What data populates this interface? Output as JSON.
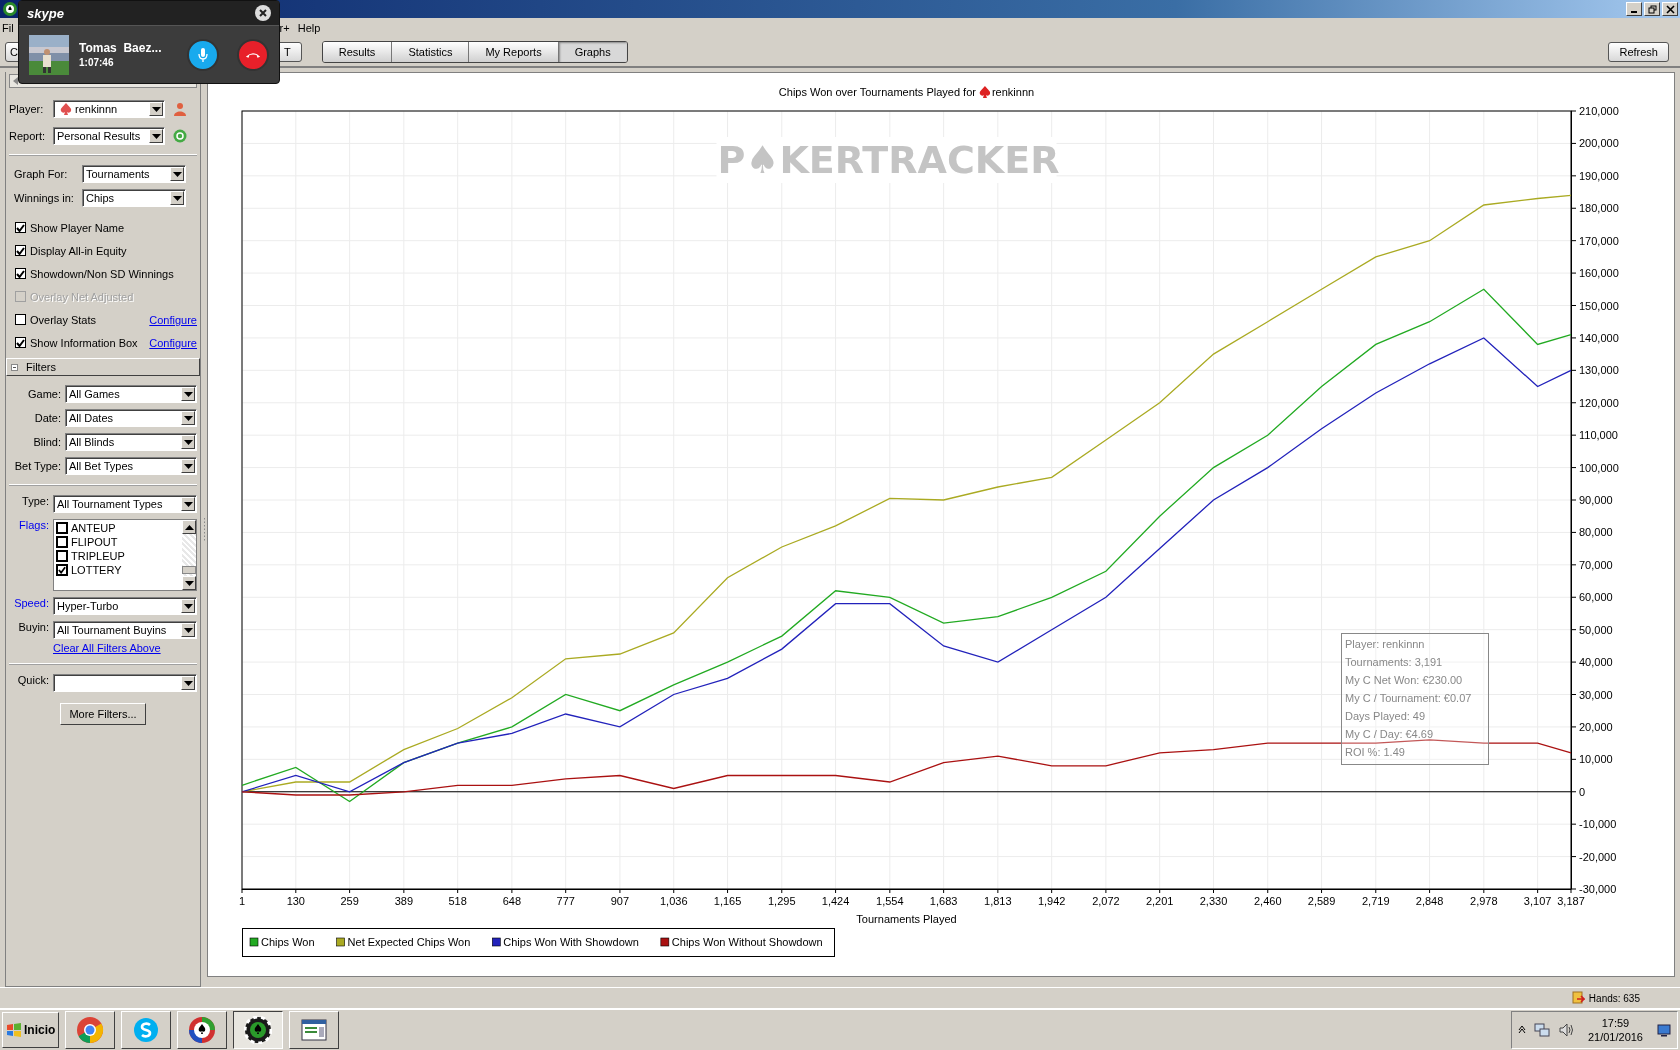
{
  "skype_call": {
    "logo": "skype",
    "caller": "Tomas  Baez...",
    "duration": "1:07:46"
  },
  "menu": [
    "Fil",
    "r+",
    "Help"
  ],
  "toolbar": {
    "left_buttons": [
      "C",
      "T"
    ],
    "tabs": [
      {
        "label": "Results",
        "selected": false
      },
      {
        "label": "Statistics",
        "selected": false
      },
      {
        "label": "My Reports",
        "selected": false
      },
      {
        "label": "Graphs",
        "selected": true
      }
    ],
    "refresh": "Refresh"
  },
  "sidebar": {
    "selectors": [
      {
        "label": "Player:",
        "value": "renkinnn",
        "kind": "player"
      },
      {
        "label": "Report:",
        "value": "Personal Results",
        "kind": "report"
      }
    ],
    "graph_settings": [
      {
        "label": "Graph For:",
        "value": "Tournaments"
      },
      {
        "label": "Winnings in:",
        "value": "Chips"
      }
    ],
    "options": [
      {
        "label": "Show Player Name",
        "checked": true,
        "disabled": false
      },
      {
        "label": "Display All-in Equity",
        "checked": true,
        "disabled": false
      },
      {
        "label": "Showdown/Non SD Winnings",
        "checked": true,
        "disabled": false
      },
      {
        "label": "Overlay Net Adjusted",
        "checked": false,
        "disabled": true
      },
      {
        "label": "Overlay Stats",
        "checked": false,
        "disabled": false,
        "link": "Configure"
      },
      {
        "label": "Show Information Box",
        "checked": true,
        "disabled": false,
        "link": "Configure"
      }
    ],
    "filters_header": "Filters",
    "filters": [
      {
        "label": "Game:",
        "value": "All Games"
      },
      {
        "label": "Date:",
        "value": "All Dates"
      },
      {
        "label": "Blind:",
        "value": "All Blinds"
      },
      {
        "label": "Bet Type:",
        "value": "All Bet Types"
      }
    ],
    "tournament_filters": [
      {
        "kind": "dropdown",
        "label": "Type:",
        "value": "All Tournament Types",
        "highlighted": false
      },
      {
        "kind": "checklist",
        "label": "Flags:",
        "highlighted": true,
        "items": [
          {
            "label": "ANTEUP",
            "checked": false
          },
          {
            "label": "FLIPOUT",
            "checked": false
          },
          {
            "label": "TRIPLEUP",
            "checked": false
          },
          {
            "label": "LOTTERY",
            "checked": true
          }
        ]
      },
      {
        "kind": "dropdown",
        "label": "Speed:",
        "value": "Hyper-Turbo",
        "highlighted": true
      },
      {
        "kind": "dropdown",
        "label": "Buyin:",
        "value": "All Tournament Buyins",
        "highlighted": false
      }
    ],
    "clear_link": "Clear All Filters Above",
    "quick": {
      "label": "Quick:"
    },
    "more_filters": "More Filters..."
  },
  "chart": {
    "title": "Chips Won over Tournaments Played for",
    "title_player": "renkinnn",
    "watermark": "P♠KERTRACKER",
    "chart_data": {
      "type": "line",
      "xlabel": "Tournaments Played",
      "x": [
        1,
        130,
        259,
        389,
        518,
        648,
        777,
        907,
        1036,
        1165,
        1295,
        1424,
        1554,
        1683,
        1813,
        1942,
        2072,
        2201,
        2330,
        2460,
        2589,
        2719,
        2848,
        2978,
        3107,
        3187
      ],
      "series": [
        {
          "name": "Chips Won",
          "color": "#22aa22",
          "values": [
            2000,
            7500,
            -3000,
            9000,
            15000,
            20000,
            30000,
            25000,
            33000,
            40000,
            48000,
            62000,
            60000,
            52000,
            54000,
            60000,
            68000,
            85000,
            100000,
            110000,
            125000,
            138000,
            145000,
            155000,
            138000,
            141000
          ]
        },
        {
          "name": "Net Expected Chips Won",
          "color": "#aaaa22",
          "values": [
            0,
            3000,
            3000,
            13000,
            19500,
            29000,
            41000,
            42500,
            49000,
            66000,
            75500,
            82000,
            90500,
            90000,
            94000,
            97000,
            108500,
            120000,
            135000,
            145000,
            155000,
            165000,
            170000,
            181000,
            183000,
            184000
          ]
        },
        {
          "name": "Chips Won With Showdown",
          "color": "#2222bb",
          "values": [
            0,
            5000,
            0,
            9000,
            15000,
            18000,
            24000,
            20000,
            30000,
            35000,
            44000,
            58000,
            58000,
            45000,
            40000,
            50000,
            60000,
            75000,
            90000,
            100000,
            112000,
            123000,
            132000,
            140000,
            125000,
            130000
          ]
        },
        {
          "name": "Chips Won Without Showdown",
          "color": "#aa1111",
          "values": [
            0,
            -1000,
            -1000,
            0,
            2000,
            2000,
            4000,
            5000,
            1000,
            5000,
            5000,
            5000,
            3000,
            9000,
            11000,
            8000,
            8000,
            12000,
            13000,
            15000,
            15000,
            15000,
            16000,
            15000,
            15000,
            12000
          ]
        }
      ],
      "grid": true,
      "legend": true,
      "xlim": [
        1,
        3187
      ],
      "ylim": [
        -30000,
        210000
      ],
      "xticks": [
        {
          "value": 1,
          "label": "1"
        },
        {
          "value": 130,
          "label": "130"
        },
        {
          "value": 259,
          "label": "259"
        },
        {
          "value": 389,
          "label": "389"
        },
        {
          "value": 518,
          "label": "518"
        },
        {
          "value": 648,
          "label": "648"
        },
        {
          "value": 777,
          "label": "777"
        },
        {
          "value": 907,
          "label": "907"
        },
        {
          "value": 1036,
          "label": "1,036"
        },
        {
          "value": 1165,
          "label": "1,165"
        },
        {
          "value": 1295,
          "label": "1,295"
        },
        {
          "value": 1424,
          "label": "1,424"
        },
        {
          "value": 1554,
          "label": "1,554"
        },
        {
          "value": 1683,
          "label": "1,683"
        },
        {
          "value": 1813,
          "label": "1,813"
        },
        {
          "value": 1942,
          "label": "1,942"
        },
        {
          "value": 2072,
          "label": "2,072"
        },
        {
          "value": 2201,
          "label": "2,201"
        },
        {
          "value": 2330,
          "label": "2,330"
        },
        {
          "value": 2460,
          "label": "2,460"
        },
        {
          "value": 2589,
          "label": "2,589"
        },
        {
          "value": 2719,
          "label": "2,719"
        },
        {
          "value": 2848,
          "label": "2,848"
        },
        {
          "value": 2978,
          "label": "2,978"
        },
        {
          "value": 3107,
          "label": "3,107"
        },
        {
          "value": 3187,
          "label": "3,187"
        }
      ],
      "yticks": [
        {
          "value": -30000,
          "label": "-30,000"
        },
        {
          "value": -20000,
          "label": "-20,000"
        },
        {
          "value": -10000,
          "label": "-10,000"
        },
        {
          "value": 0,
          "label": "0"
        },
        {
          "value": 10000,
          "label": "10,000"
        },
        {
          "value": 20000,
          "label": "20,000"
        },
        {
          "value": 30000,
          "label": "30,000"
        },
        {
          "value": 40000,
          "label": "40,000"
        },
        {
          "value": 50000,
          "label": "50,000"
        },
        {
          "value": 60000,
          "label": "60,000"
        },
        {
          "value": 70000,
          "label": "70,000"
        },
        {
          "value": 80000,
          "label": "80,000"
        },
        {
          "value": 90000,
          "label": "90,000"
        },
        {
          "value": 100000,
          "label": "100,000"
        },
        {
          "value": 110000,
          "label": "110,000"
        },
        {
          "value": 120000,
          "label": "120,000"
        },
        {
          "value": 130000,
          "label": "130,000"
        },
        {
          "value": 140000,
          "label": "140,000"
        },
        {
          "value": 150000,
          "label": "150,000"
        },
        {
          "value": 160000,
          "label": "160,000"
        },
        {
          "value": 170000,
          "label": "170,000"
        },
        {
          "value": 180000,
          "label": "180,000"
        },
        {
          "value": 190000,
          "label": "190,000"
        },
        {
          "value": 200000,
          "label": "200,000"
        },
        {
          "value": 210000,
          "label": "210,000"
        }
      ]
    },
    "info_box": [
      "Player: renkinnn",
      "Tournaments: 3,191",
      "My C Net Won: €230.00",
      "My C / Tournament: €0.07",
      "Days Played: 49",
      "My C / Day: €4.69",
      "ROI %: 1.49"
    ]
  },
  "status_bar": {
    "hands": "Hands: 635"
  },
  "taskbar": {
    "start": "Inicio",
    "apps": [
      {
        "kind": "chrome",
        "selected": false
      },
      {
        "kind": "skype",
        "selected": false
      },
      {
        "kind": "cards",
        "selected": false
      },
      {
        "kind": "poker",
        "selected": true
      },
      {
        "kind": "window",
        "selected": false
      }
    ],
    "time": "17:59",
    "date": "21/01/2016"
  }
}
